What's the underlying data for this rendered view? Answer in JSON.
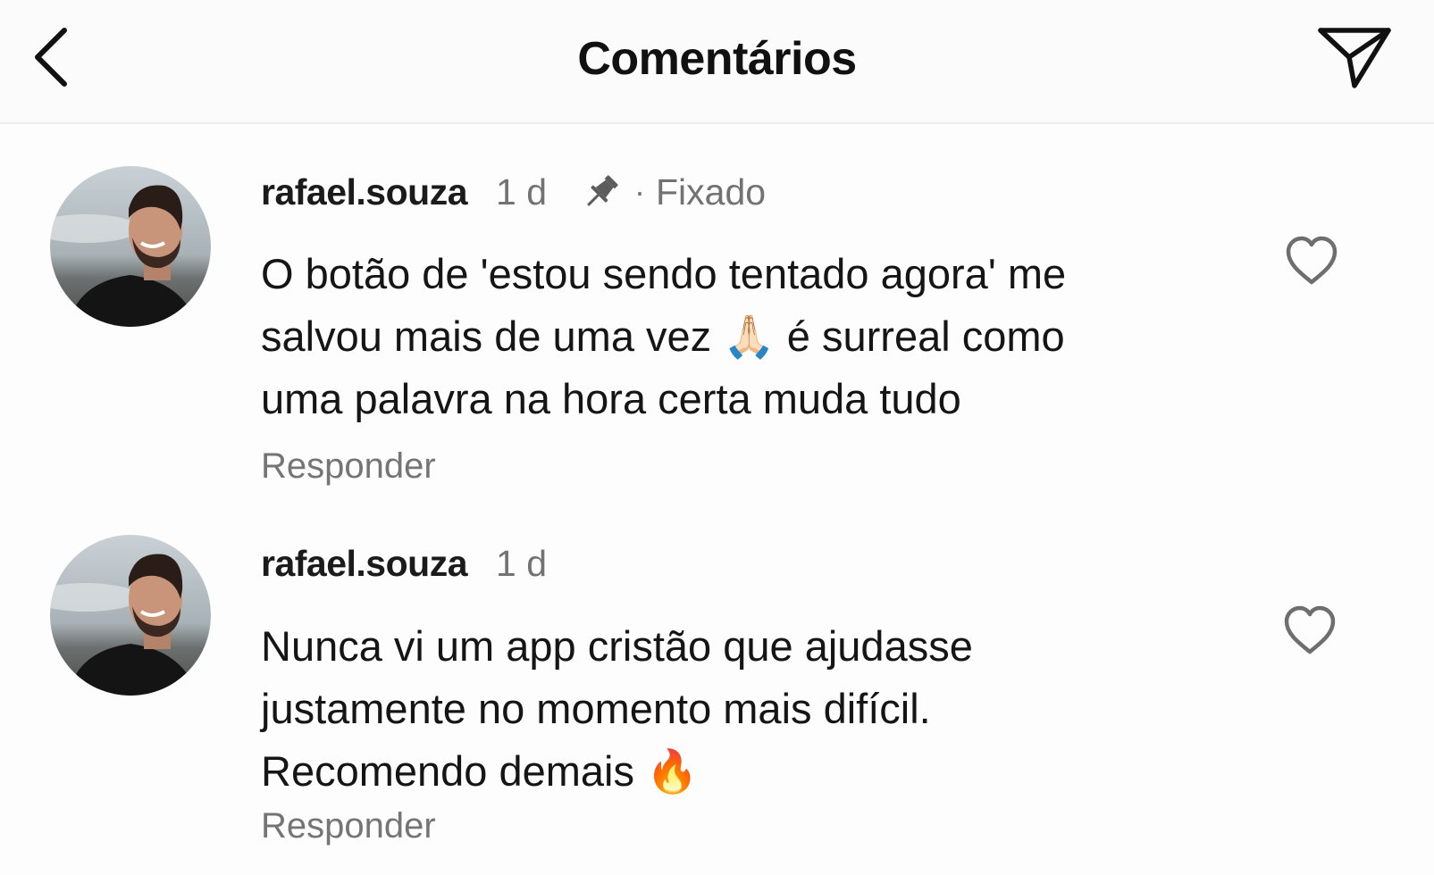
{
  "header": {
    "title": "Comentários",
    "back_icon": "chevron-left-icon",
    "send_icon": "paper-plane-icon"
  },
  "comments": [
    {
      "username": "rafael.souza",
      "time": "1 d",
      "pinned": true,
      "pin_icon": "pin-icon",
      "dot": "·",
      "pinned_label": "Fixado",
      "text": "O botão de 'estou sendo tentado agora' me\nsalvou mais de uma vez 🙏🏻 é surreal como\numa palavra na hora certa muda tudo",
      "reply_label": "Responder",
      "like_icon": "heart-outline-icon"
    },
    {
      "username": "rafael.souza",
      "time": "1 d",
      "pinned": false,
      "text": "Nunca vi um app cristão que ajudasse\njustamente no momento mais difícil.\nRecomendo demais 🔥",
      "reply_label": "Responder",
      "like_icon": "heart-outline-icon"
    }
  ],
  "colors": {
    "background": "#fdfdfd",
    "text_primary": "#151515",
    "text_secondary": "#727272",
    "divider": "#ececec"
  }
}
